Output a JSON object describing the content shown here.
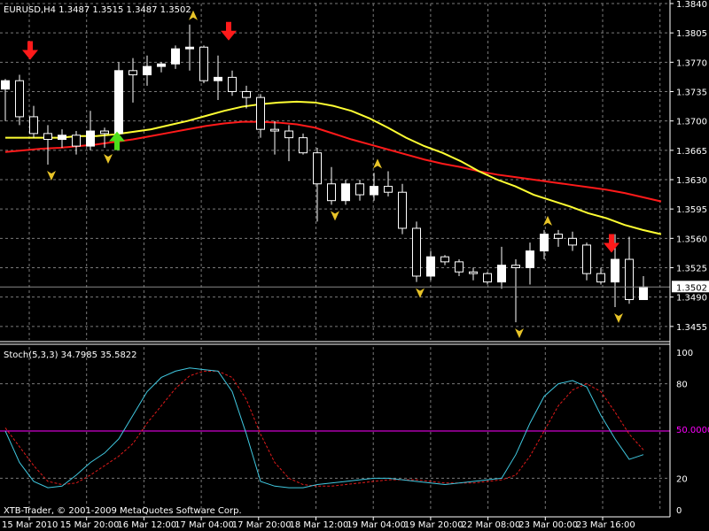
{
  "window": {
    "symbol_info": "EURUSD,H4  1.3487 1.3515 1.3487 1.3502",
    "copyright": "XTB-Trader, © 2001-2009 MetaQuotes Software Corp."
  },
  "colors": {
    "background": "#000000",
    "grid": "#7a7a7a",
    "axis": "#ffffff",
    "candle_bull": "#ffffff",
    "candle_bear": "#000000",
    "wick": "#ffffff",
    "ma_fast": "#ffff33",
    "ma_slow": "#ff1a1a",
    "stoch_main": "#40c8e0",
    "stoch_signal": "#e01a1a",
    "level_50": "#ff00ff",
    "fractal": "#e8c428",
    "arrow_down": "#ff1a1a",
    "arrow_up": "#4de01a"
  },
  "chart_data": [
    {
      "type": "candlestick",
      "title": "EURUSD,H4  1.3487 1.3515 1.3487 1.3502",
      "ylim": [
        1.3439,
        1.384
      ],
      "y_ticks": [
        "1.3840",
        "1.3805",
        "1.3770",
        "1.3735",
        "1.3700",
        "1.3665",
        "1.3630",
        "1.3595",
        "1.3560",
        "1.3525",
        "1.3490",
        "1.3455"
      ],
      "current_price": "1.3502",
      "x_labels": [
        "15 Mar 2010",
        "15 Mar 20:00",
        "16 Mar 12:00",
        "17 Mar 04:00",
        "17 Mar 20:00",
        "18 Mar 12:00",
        "19 Mar 04:00",
        "19 Mar 20:00",
        "22 Mar 08:00",
        "23 Mar 00:00",
        "23 Mar 16:00"
      ],
      "candles": [
        {
          "o": 1.3738,
          "h": 1.375,
          "l": 1.37,
          "c": 1.3748
        },
        {
          "o": 1.3748,
          "h": 1.3755,
          "l": 1.3695,
          "c": 1.3705
        },
        {
          "o": 1.3705,
          "h": 1.3718,
          "l": 1.368,
          "c": 1.3685
        },
        {
          "o": 1.3685,
          "h": 1.3695,
          "l": 1.3648,
          "c": 1.3678
        },
        {
          "o": 1.3678,
          "h": 1.369,
          "l": 1.3668,
          "c": 1.3683
        },
        {
          "o": 1.3683,
          "h": 1.3688,
          "l": 1.366,
          "c": 1.367
        },
        {
          "o": 1.367,
          "h": 1.3712,
          "l": 1.3665,
          "c": 1.3688
        },
        {
          "o": 1.3688,
          "h": 1.3692,
          "l": 1.3668,
          "c": 1.3685
        },
        {
          "o": 1.3685,
          "h": 1.377,
          "l": 1.368,
          "c": 1.376
        },
        {
          "o": 1.376,
          "h": 1.3775,
          "l": 1.3722,
          "c": 1.3755
        },
        {
          "o": 1.3755,
          "h": 1.3778,
          "l": 1.3742,
          "c": 1.3765
        },
        {
          "o": 1.3765,
          "h": 1.377,
          "l": 1.3758,
          "c": 1.3768
        },
        {
          "o": 1.3768,
          "h": 1.379,
          "l": 1.3762,
          "c": 1.3786
        },
        {
          "o": 1.3786,
          "h": 1.3815,
          "l": 1.376,
          "c": 1.3788
        },
        {
          "o": 1.3788,
          "h": 1.379,
          "l": 1.3745,
          "c": 1.3748
        },
        {
          "o": 1.3748,
          "h": 1.3778,
          "l": 1.3725,
          "c": 1.3752
        },
        {
          "o": 1.3752,
          "h": 1.376,
          "l": 1.373,
          "c": 1.3735
        },
        {
          "o": 1.3735,
          "h": 1.3742,
          "l": 1.3715,
          "c": 1.3728
        },
        {
          "o": 1.3728,
          "h": 1.3732,
          "l": 1.368,
          "c": 1.369
        },
        {
          "o": 1.369,
          "h": 1.37,
          "l": 1.366,
          "c": 1.3688
        },
        {
          "o": 1.3688,
          "h": 1.3695,
          "l": 1.3652,
          "c": 1.368
        },
        {
          "o": 1.368,
          "h": 1.3685,
          "l": 1.366,
          "c": 1.3662
        },
        {
          "o": 1.3662,
          "h": 1.3668,
          "l": 1.358,
          "c": 1.3625
        },
        {
          "o": 1.3625,
          "h": 1.3645,
          "l": 1.36,
          "c": 1.3605
        },
        {
          "o": 1.3605,
          "h": 1.363,
          "l": 1.36,
          "c": 1.3625
        },
        {
          "o": 1.3625,
          "h": 1.363,
          "l": 1.3605,
          "c": 1.3612
        },
        {
          "o": 1.3612,
          "h": 1.3638,
          "l": 1.3605,
          "c": 1.3622
        },
        {
          "o": 1.3622,
          "h": 1.364,
          "l": 1.361,
          "c": 1.3615
        },
        {
          "o": 1.3615,
          "h": 1.3625,
          "l": 1.3565,
          "c": 1.3572
        },
        {
          "o": 1.3572,
          "h": 1.358,
          "l": 1.3508,
          "c": 1.3515
        },
        {
          "o": 1.3515,
          "h": 1.3545,
          "l": 1.351,
          "c": 1.3538
        },
        {
          "o": 1.3538,
          "h": 1.354,
          "l": 1.3528,
          "c": 1.3532
        },
        {
          "o": 1.3532,
          "h": 1.3535,
          "l": 1.3515,
          "c": 1.352
        },
        {
          "o": 1.352,
          "h": 1.3525,
          "l": 1.351,
          "c": 1.3518
        },
        {
          "o": 1.3518,
          "h": 1.352,
          "l": 1.3505,
          "c": 1.3508
        },
        {
          "o": 1.3508,
          "h": 1.355,
          "l": 1.35,
          "c": 1.3528
        },
        {
          "o": 1.3528,
          "h": 1.3535,
          "l": 1.346,
          "c": 1.3525
        },
        {
          "o": 1.3525,
          "h": 1.3555,
          "l": 1.3505,
          "c": 1.3545
        },
        {
          "o": 1.3545,
          "h": 1.357,
          "l": 1.3535,
          "c": 1.3565
        },
        {
          "o": 1.3565,
          "h": 1.357,
          "l": 1.355,
          "c": 1.356
        },
        {
          "o": 1.356,
          "h": 1.3568,
          "l": 1.3545,
          "c": 1.3552
        },
        {
          "o": 1.3552,
          "h": 1.3555,
          "l": 1.351,
          "c": 1.3518
        },
        {
          "o": 1.3518,
          "h": 1.3525,
          "l": 1.3505,
          "c": 1.3508
        },
        {
          "o": 1.3508,
          "h": 1.3565,
          "l": 1.3478,
          "c": 1.3535
        },
        {
          "o": 1.3535,
          "h": 1.3562,
          "l": 1.3482,
          "c": 1.3487
        },
        {
          "o": 1.3487,
          "h": 1.3515,
          "l": 1.3487,
          "c": 1.3502
        }
      ],
      "ma_fast": [
        1.368,
        1.368,
        1.368,
        1.368,
        1.3682,
        1.3682,
        1.3684,
        1.3687,
        1.369,
        1.3695,
        1.37,
        1.3706,
        1.3712,
        1.3717,
        1.372,
        1.3722,
        1.3723,
        1.3722,
        1.3718,
        1.3712,
        1.3703,
        1.3692,
        1.368,
        1.367,
        1.3662,
        1.3652,
        1.364,
        1.363,
        1.3622,
        1.3612,
        1.3605,
        1.3598,
        1.359,
        1.3584,
        1.3576,
        1.357,
        1.3565
      ],
      "ma_slow": [
        1.3663,
        1.3665,
        1.3667,
        1.3668,
        1.367,
        1.3672,
        1.3675,
        1.3678,
        1.3682,
        1.3686,
        1.369,
        1.3694,
        1.3697,
        1.3699,
        1.3699,
        1.3698,
        1.3696,
        1.3692,
        1.3685,
        1.3678,
        1.3672,
        1.3666,
        1.366,
        1.3654,
        1.3649,
        1.3645,
        1.364,
        1.3636,
        1.3633,
        1.363,
        1.3627,
        1.3624,
        1.3621,
        1.3618,
        1.3614,
        1.3609,
        1.3604
      ],
      "fractals_up": [
        13,
        26,
        38
      ],
      "fractals_down": [
        3,
        7,
        23,
        29,
        36,
        43
      ],
      "arrows_down": [
        1,
        15,
        42
      ],
      "arrows_up": [
        8
      ]
    },
    {
      "type": "line",
      "title": "Stoch(5,3,3) 34.7985 35.5822",
      "ylim": [
        0,
        100
      ],
      "y_ticks": [
        0,
        20,
        50,
        80,
        100
      ],
      "level_50_label": "50.0000",
      "series": [
        {
          "name": "main",
          "values": [
            50,
            30,
            18,
            14,
            15,
            22,
            30,
            36,
            45,
            60,
            75,
            84,
            88,
            90,
            89,
            88,
            75,
            48,
            18,
            15,
            14,
            14,
            16,
            17,
            18,
            19,
            20,
            20,
            19,
            18,
            17,
            16,
            17,
            18,
            19,
            20,
            35,
            55,
            72,
            80,
            82,
            78,
            60,
            45,
            32,
            35
          ]
        },
        {
          "name": "signal",
          "values": [
            52,
            40,
            28,
            18,
            16,
            17,
            22,
            28,
            34,
            42,
            55,
            66,
            77,
            85,
            88,
            88,
            84,
            70,
            48,
            30,
            20,
            16,
            15,
            15,
            16,
            17,
            18,
            19,
            19,
            19,
            18,
            17,
            17,
            17,
            18,
            19,
            22,
            34,
            50,
            66,
            76,
            80,
            75,
            62,
            48,
            38
          ]
        }
      ]
    }
  ]
}
